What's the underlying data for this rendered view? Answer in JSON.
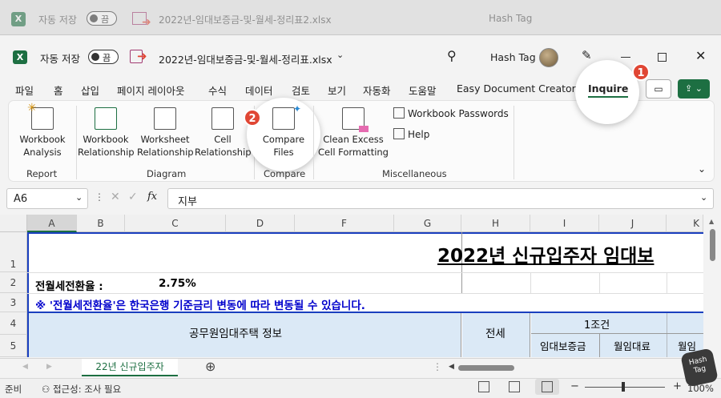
{
  "ghost": {
    "autosave_label": "자동 저장",
    "toggle_state": "끔",
    "filename": "2022년-임대보증금-및-월세-정리표2.xlsx",
    "user": "Hash Tag"
  },
  "titlebar": {
    "autosave_label": "자동 저장",
    "toggle_state": "끔",
    "filename": "2022년-임대보증금-및-월세-정리표.xlsx",
    "user": "Hash Tag"
  },
  "menu": [
    "파일",
    "홈",
    "삽입",
    "페이지 레이아웃",
    "수식",
    "데이터",
    "검토",
    "보기",
    "자동화",
    "도움말",
    "Easy Document Creator",
    "Inquire"
  ],
  "ribbon": {
    "report": {
      "label": "Report",
      "buttons": [
        [
          "Workbook",
          "Analysis"
        ]
      ]
    },
    "diagram": {
      "label": "Diagram",
      "buttons": [
        [
          "Workbook",
          "Relationship"
        ],
        [
          "Worksheet",
          "Relationship"
        ],
        [
          "Cell",
          "Relationship"
        ]
      ]
    },
    "compare": {
      "label": "Compare",
      "buttons": [
        [
          "Compare",
          "Files"
        ]
      ]
    },
    "misc": {
      "label": "Miscellaneous",
      "big": [
        "Clean Excess",
        "Cell Formatting"
      ],
      "small": [
        "Workbook Passwords",
        "Help"
      ]
    }
  },
  "badges": [
    "1",
    "2"
  ],
  "formula_bar": {
    "namebox": "A6",
    "fx": "fx",
    "content": "지부"
  },
  "grid": {
    "columns": [
      "A",
      "B",
      "C",
      "D",
      "F",
      "G",
      "H",
      "I",
      "J",
      "K"
    ],
    "rows": [
      "1",
      "2",
      "3",
      "4",
      "5"
    ],
    "title": "2022년 신규입주자 임대보",
    "rate_label": "전월세전환율 :",
    "rate_value": "2.75%",
    "note": "※ '전월세전환율'은 한국은행 기준금리 변동에 따라 변동될 수 있습니다.",
    "info_header": "공무원임대주택 정보",
    "jeonse": "전세",
    "condition": "1조건",
    "deposit": "임대보증금",
    "monthly": "월임대료",
    "partial": "월임"
  },
  "sheet_tab": "22년 신규입주자",
  "status": {
    "ready": "준비",
    "accessibility": "접근성: 조사 필요",
    "zoom": "100%"
  },
  "colors": {
    "excel_green": "#1d6f42",
    "badge_red": "#e04634",
    "note_blue": "#0000cc",
    "header_fill": "#dbe9f6"
  }
}
